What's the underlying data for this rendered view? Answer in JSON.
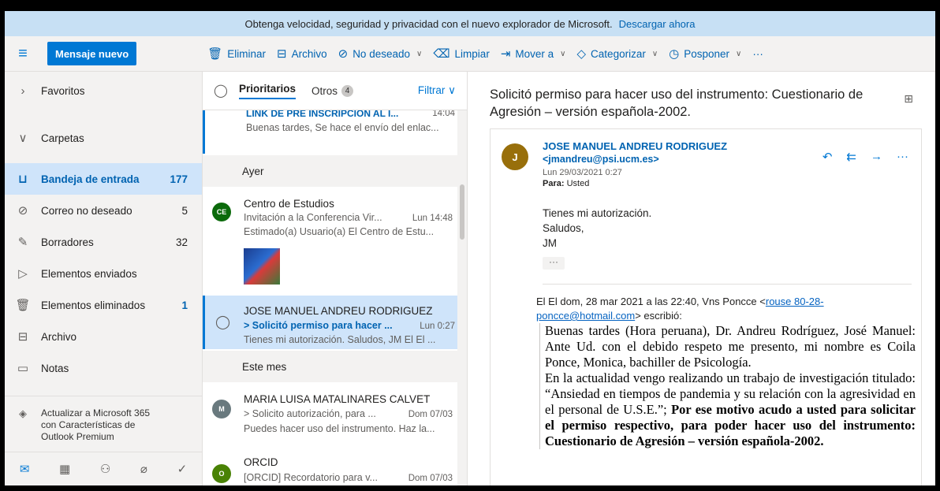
{
  "banner": {
    "text": "Obtenga velocidad, seguridad y privacidad con el nuevo explorador de Microsoft.",
    "link": "Descargar ahora"
  },
  "toolbar": {
    "new_message": "Mensaje nuevo",
    "actions": [
      {
        "label": "Eliminar",
        "icon": "trash-icon"
      },
      {
        "label": "Archivo",
        "icon": "archive-icon"
      },
      {
        "label": "No deseado",
        "icon": "block-icon"
      },
      {
        "label": "Limpiar",
        "icon": "broom-icon"
      },
      {
        "label": "Mover a",
        "icon": "move-icon"
      },
      {
        "label": "Categorizar",
        "icon": "tag-icon"
      },
      {
        "label": "Posponer",
        "icon": "clock-icon"
      }
    ],
    "more": "···"
  },
  "nav": {
    "favoritos": "Favoritos",
    "carpetas": "Carpetas",
    "folders": [
      {
        "label": "Bandeja de entrada",
        "count": "177"
      },
      {
        "label": "Correo no deseado",
        "count": "5"
      },
      {
        "label": "Borradores",
        "count": "32"
      },
      {
        "label": "Elementos enviados",
        "count": ""
      },
      {
        "label": "Elementos eliminados",
        "count": "1"
      },
      {
        "label": "Archivo",
        "count": ""
      },
      {
        "label": "Notas",
        "count": ""
      }
    ],
    "upgrade": "Actualizar a Microsoft 365 con Características de Outlook Premium"
  },
  "list": {
    "tab_focused": "Prioritarios",
    "tab_other": "Otros",
    "other_count": "4",
    "filter": "Filtrar",
    "items": [
      {
        "sender": "LINK DE PRE INSCRIPCION AL I...",
        "time": "14:04",
        "preview": "Buenas tardes, Se hace el envío del enlac..."
      },
      {
        "avatar": "CE",
        "sender": "Centro de Estudios",
        "subject": "Invitación a la Conferencia Vir...",
        "time": "Lun 14:48",
        "preview": "Estimado(a) Usuario(a) El Centro de Estu..."
      },
      {
        "sender": "JOSE MANUEL ANDREU RODRIGUEZ",
        "subject": "> Solicitó permiso para hacer ...",
        "time": "Lun 0:27",
        "preview": "Tienes mi autorización. Saludos, JM El El ..."
      },
      {
        "avatar": "M",
        "sender": "MARIA LUISA MATALINARES CALVET",
        "subject": "> Solicito autorización, para ...",
        "time": "Dom 07/03",
        "preview": "Puedes hacer uso del instrumento. Haz la..."
      },
      {
        "avatar": "O",
        "sender": "ORCID",
        "subject": "[ORCID] Recordatorio para v...",
        "time": "Dom 07/03"
      }
    ],
    "group_ayer": "Ayer",
    "group_mes": "Este mes"
  },
  "reading": {
    "title": "Solicitó permiso para hacer uso del instrumento: Cuestionario de Agresión – versión española-2002.",
    "avatar": "J",
    "from": "JOSE MANUEL ANDREU RODRIGUEZ",
    "email": "<jmandreu@psi.ucm.es>",
    "date": "Lun 29/03/2021 0:27",
    "to_label": "Para:",
    "to": "Usted",
    "body_lines": [
      "Tienes mi autorización.",
      "Saludos,",
      "JM"
    ],
    "more": "···",
    "quote_header_a": "El El dom, 28 mar 2021 a las 22:40, Vns Poncce <",
    "quote_link": "rouse 80-28-poncce@hotmail.com",
    "quote_header_b": "> escribió:",
    "quote_p1": "Buenas tardes (Hora peruana), Dr. Andreu Rodríguez, José Manuel: Ante Ud. con el debido respeto me presento, mi nombre es Coila Ponce, Monica, bachiller de Psicología.",
    "quote_p2a": "En la actualidad vengo realizando un trabajo de investigación titulado: “Ansiedad en tiempos de pandemia y su relación con la agresividad en el personal de U.S.E.”;",
    "quote_p2b": "Por ese motivo acudo a usted para solicitar el permiso respectivo, para poder hacer uso del instrumento: Cuestionario de Agresión – versión española-2002."
  },
  "colors": {
    "accent": "#0078d4",
    "selected": "#cfe4fa",
    "banner": "#c7e0f4"
  }
}
